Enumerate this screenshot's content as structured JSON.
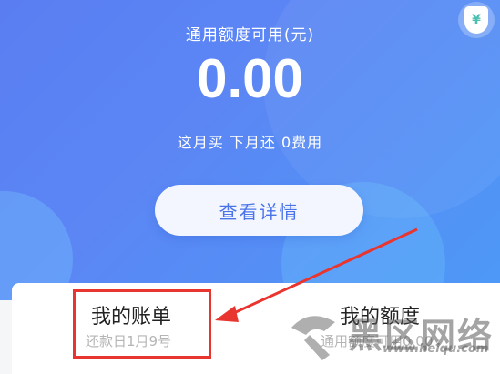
{
  "hero": {
    "label": "通用额度可用(元)",
    "amount": "0.00",
    "subtitle": "这月买 下月还 0费用",
    "detail_button": "查看详情",
    "shield_symbol": "¥"
  },
  "cards": {
    "bill": {
      "title": "我的账单",
      "subtitle": "还款日1月9号"
    },
    "quota": {
      "title": "我的额度",
      "subtitle": "通用额度可用0.00"
    }
  },
  "watermark": {
    "text": "黑区网络",
    "url": "www.heiqu.com"
  },
  "colors": {
    "hero_blue": "#5a86f4",
    "highlight_red": "#e8352f",
    "button_text": "#4a74e8"
  }
}
